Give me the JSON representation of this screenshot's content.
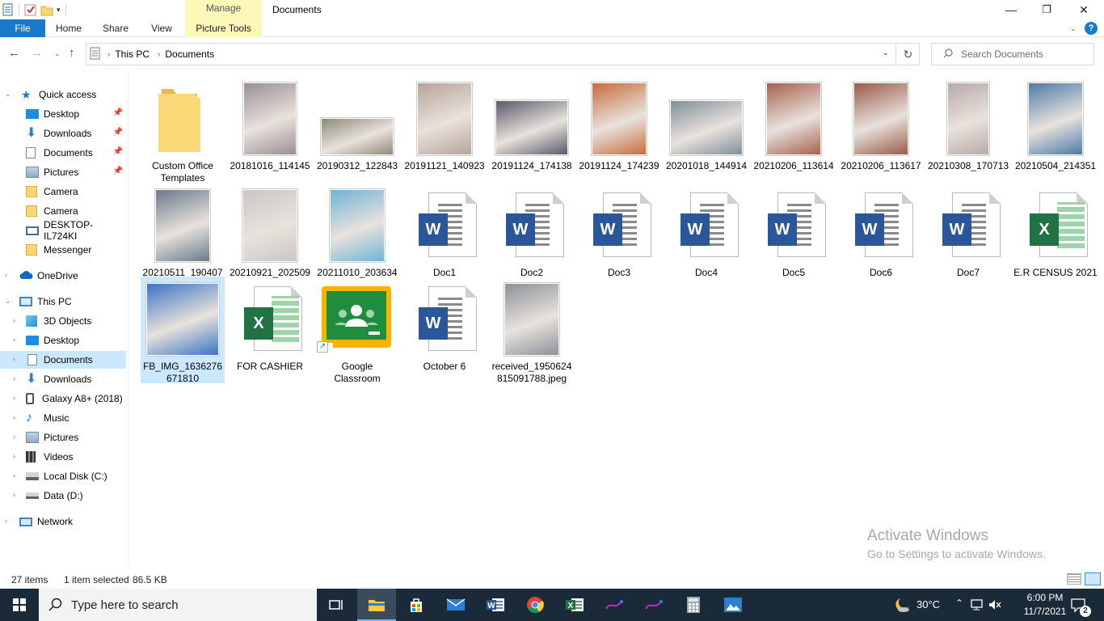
{
  "window": {
    "title": "Documents",
    "manage_label": "Manage",
    "minimize": "—",
    "maximize": "❐",
    "close": "✕"
  },
  "ribbon": {
    "tabs": [
      "File",
      "Home",
      "Share",
      "View",
      "Picture Tools"
    ]
  },
  "address": {
    "crumbs": [
      "This PC",
      "Documents"
    ],
    "search_placeholder": "Search Documents"
  },
  "nav": {
    "quick_access": "Quick access",
    "quick_items": [
      "Desktop",
      "Downloads",
      "Documents",
      "Pictures",
      "Camera",
      "Camera",
      "DESKTOP-IL724KI",
      "Messenger"
    ],
    "onedrive": "OneDrive",
    "this_pc": "This PC",
    "pc_items": [
      "3D Objects",
      "Desktop",
      "Documents",
      "Downloads",
      "Galaxy A8+ (2018)",
      "Music",
      "Pictures",
      "Videos",
      "Local Disk (C:)",
      "Data (D:)"
    ],
    "network": "Network"
  },
  "files": [
    {
      "name": "Custom Office Templates",
      "kind": "folder"
    },
    {
      "name": "20181016_114145",
      "kind": "photo",
      "color": "#9a8f93"
    },
    {
      "name": "20190312_122843",
      "kind": "photo",
      "color": "#8d8a78"
    },
    {
      "name": "20191121_140923",
      "kind": "photo",
      "color": "#b7a49c"
    },
    {
      "name": "20191124_174138",
      "kind": "photo",
      "color": "#5a5a6a"
    },
    {
      "name": "20191124_174239",
      "kind": "photo",
      "color": "#c96b3c"
    },
    {
      "name": "20201018_144914",
      "kind": "photo",
      "color": "#7f8f99"
    },
    {
      "name": "20210206_113614",
      "kind": "photo",
      "color": "#a7604e"
    },
    {
      "name": "20210206_113617",
      "kind": "photo",
      "color": "#9a5a4a"
    },
    {
      "name": "20210308_170713",
      "kind": "photo",
      "color": "#b8aaa8"
    },
    {
      "name": "20210504_214351",
      "kind": "photo",
      "color": "#4d7aa8"
    },
    {
      "name": "20210511_190407",
      "kind": "photo",
      "color": "#6a7a8c"
    },
    {
      "name": "20210921_202509",
      "kind": "photo",
      "color": "#c9c6c4"
    },
    {
      "name": "20211010_203634",
      "kind": "photo",
      "color": "#6fb3d9"
    },
    {
      "name": "Doc1",
      "kind": "word"
    },
    {
      "name": "Doc2",
      "kind": "word"
    },
    {
      "name": "Doc3",
      "kind": "word"
    },
    {
      "name": "Doc4",
      "kind": "word"
    },
    {
      "name": "Doc5",
      "kind": "word"
    },
    {
      "name": "Doc6",
      "kind": "word"
    },
    {
      "name": "Doc7",
      "kind": "word"
    },
    {
      "name": "E.R CENSUS 2021",
      "kind": "excel"
    },
    {
      "name": "FB_IMG_1636276671810",
      "kind": "photo",
      "color": "#3b74c4"
    },
    {
      "name": "FOR CASHIER",
      "kind": "excel"
    },
    {
      "name": "Google Classroom",
      "kind": "classroom"
    },
    {
      "name": "October 6",
      "kind": "word"
    },
    {
      "name": "received_1950624815091788.jpeg",
      "kind": "photo",
      "color": "#8c9299"
    }
  ],
  "file_labels": {
    "f0a": "Custom Office",
    "f0b": "Templates",
    "f22a": "FB_IMG_1636276",
    "f22b": "671810",
    "f24a": "Google",
    "f24b": "Classroom",
    "f26a": "received_1950624",
    "f26b": "815091788.jpeg"
  },
  "status": {
    "items": "27 items",
    "selected": "1 item selected",
    "size": "86.5 KB"
  },
  "watermark": {
    "line1": "Activate Windows",
    "line2": "Go to Settings to activate Windows."
  },
  "taskbar": {
    "search_placeholder": "Type here to search",
    "weather": "30°C",
    "time": "6:00 PM",
    "date": "11/7/2021",
    "notifications": "2"
  },
  "colors": {
    "accent": "#1979ca",
    "selection": "#cce8ff",
    "manage_tab": "#fcf8b8",
    "taskbar": "#1b2a38"
  }
}
